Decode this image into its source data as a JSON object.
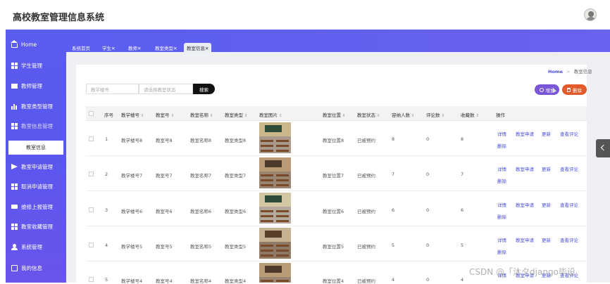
{
  "app": {
    "title": "高校教室管理信息系统"
  },
  "sidebar": {
    "items": [
      {
        "label": "Home",
        "icon": "home-icon"
      },
      {
        "label": "学生管理",
        "icon": "grid-icon"
      },
      {
        "label": "教师管理",
        "icon": "monitor-icon"
      },
      {
        "label": "教室类型管理",
        "icon": "bar-chart-icon"
      },
      {
        "label": "教室信息管理",
        "icon": "grid-icon"
      },
      {
        "label": "教室申请管理",
        "icon": "send-icon"
      },
      {
        "label": "取消申请管理",
        "icon": "grid-icon"
      },
      {
        "label": "维修上报管理",
        "icon": "ticket-icon"
      },
      {
        "label": "教室收藏管理",
        "icon": "grid-icon"
      },
      {
        "label": "系统管理",
        "icon": "user-icon"
      },
      {
        "label": "我的信息",
        "icon": "box-icon"
      }
    ],
    "sub_item": "教室信息"
  },
  "tabs": [
    {
      "label": "系统首页"
    },
    {
      "label": "学生✕"
    },
    {
      "label": "教师✕"
    },
    {
      "label": "教室类型✕"
    },
    {
      "label": "教室信息✕",
      "active": true
    }
  ],
  "breadcrumb": {
    "home": "Home",
    "sep": ">",
    "current": "教室信息"
  },
  "filters": {
    "building_placeholder": "教学楼号",
    "status_placeholder": "请选择教室状态",
    "search_label": "搜索"
  },
  "buttons": {
    "add": "增加",
    "delete": "删除"
  },
  "table": {
    "columns": [
      "序号",
      "教学楼号",
      "教室号",
      "教室名称",
      "教室类型",
      "教室图片",
      "教室位置",
      "教室状态",
      "容纳人数",
      "评论数",
      "收藏数",
      "操作"
    ],
    "sort_mark": "⇕",
    "rows": [
      {
        "index": "1",
        "building": "教学楼号8",
        "room": "教室号8",
        "name": "教室名称8",
        "type": "教室类型8",
        "location": "教室位置8",
        "status": "已被预约",
        "capacity": "8",
        "comments": "0",
        "favorites": "8"
      },
      {
        "index": "2",
        "building": "教学楼号7",
        "room": "教室号7",
        "name": "教室名称7",
        "type": "教室类型7",
        "location": "教室位置7",
        "status": "已被预约",
        "capacity": "7",
        "comments": "0",
        "favorites": "7"
      },
      {
        "index": "3",
        "building": "教学楼号6",
        "room": "教室号6",
        "name": "教室名称6",
        "type": "教室类型6",
        "location": "教室位置6",
        "status": "已被预约",
        "capacity": "6",
        "comments": "0",
        "favorites": "6"
      },
      {
        "index": "4",
        "building": "教学楼号5",
        "room": "教室号5",
        "name": "教室名称5",
        "type": "教室类型5",
        "location": "教室位置5",
        "status": "已被预约",
        "capacity": "5",
        "comments": "0",
        "favorites": "5"
      },
      {
        "index": "5",
        "building": "教学楼号4",
        "room": "教室号4",
        "name": "教室名称4",
        "type": "教室类型4",
        "location": "教室位置4",
        "status": "已被预约",
        "capacity": "4",
        "comments": "0",
        "favorites": "4"
      }
    ],
    "actions": [
      "详情",
      "教室申请",
      "更新",
      "查看评论",
      "删除"
    ]
  },
  "watermark": "CSDN @「沐夕django毕设"
}
